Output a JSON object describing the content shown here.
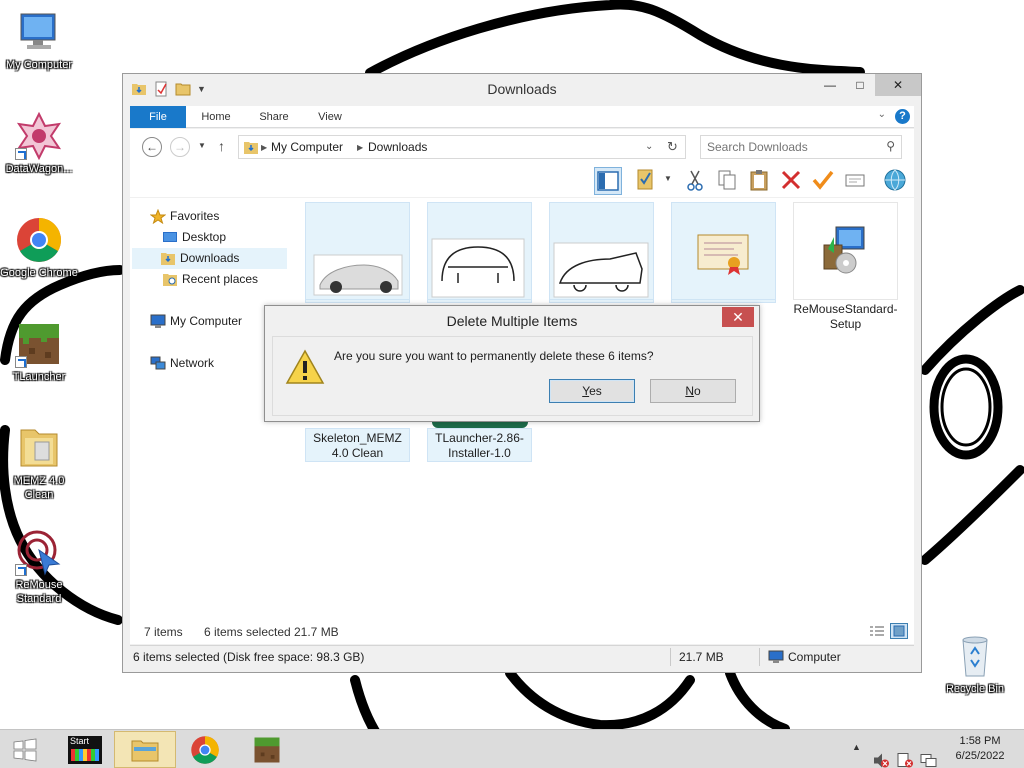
{
  "desktop": {
    "icons": [
      {
        "label": "My Computer"
      },
      {
        "label": "DataWagon..."
      },
      {
        "label": "Google Chrome"
      },
      {
        "label": "TLauncher"
      },
      {
        "label": "MEMZ 4.0 Clean"
      },
      {
        "label": "ReMouse Standard"
      },
      {
        "label": "Recycle Bin"
      }
    ]
  },
  "window": {
    "title": "Downloads",
    "ribbon_tabs": [
      "File",
      "Home",
      "Share",
      "View"
    ],
    "address": {
      "segments": [
        "My Computer",
        "Downloads"
      ]
    },
    "search": {
      "placeholder": "Search Downloads"
    },
    "nav": {
      "favorites": "Favorites",
      "desktop": "Desktop",
      "downloads": "Downloads",
      "recent": "Recent places",
      "my_computer": "My Computer",
      "network": "Network"
    },
    "files": [
      {
        "name": "",
        "selected": true
      },
      {
        "name": "",
        "selected": true
      },
      {
        "name": "",
        "selected": true
      },
      {
        "name": "",
        "selected": true
      },
      {
        "name": "ReMouseStandard-Setup",
        "selected": false
      },
      {
        "name": "Skeleton_MEMZ 4.0 Clean",
        "selected": true
      },
      {
        "name": "TLauncher-2.86-Installer-1.0",
        "selected": true
      }
    ],
    "status": {
      "item_count": "7 items",
      "selected": "6 items selected",
      "size": "21.7 MB"
    },
    "details_bar": {
      "text": "6 items selected (Disk free space: 98.3 GB)",
      "size": "21.7 MB",
      "location": "Computer"
    }
  },
  "dialog": {
    "title": "Delete Multiple Items",
    "message": "Are you sure you want to permanently delete these 6 items?",
    "yes_mnemonic": "Y",
    "yes_rest": "es",
    "no_mnemonic": "N",
    "no_rest": "o"
  },
  "taskbar": {
    "time": "1:58 PM",
    "date": "6/25/2022",
    "start_tile_label": "Start"
  },
  "colors": {
    "accent": "#1979ca",
    "selection": "#e5f3fb",
    "dialog_close": "#c75050"
  }
}
